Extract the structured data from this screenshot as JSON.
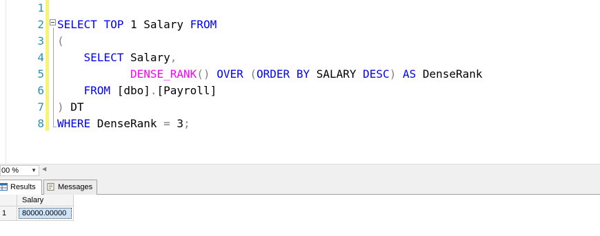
{
  "editor": {
    "line_numbers": [
      "1",
      "2",
      "3",
      "4",
      "5",
      "6",
      "7",
      "8"
    ],
    "lines": [
      [],
      [
        {
          "t": "SELECT",
          "c": "kw"
        },
        {
          "t": " ",
          "c": "id"
        },
        {
          "t": "TOP",
          "c": "kw"
        },
        {
          "t": " 1 Salary ",
          "c": "id"
        },
        {
          "t": "FROM",
          "c": "kw"
        }
      ],
      [
        {
          "t": "(",
          "c": "op"
        }
      ],
      [
        {
          "t": "    ",
          "c": "id"
        },
        {
          "t": "SELECT",
          "c": "kw"
        },
        {
          "t": " Salary",
          "c": "id"
        },
        {
          "t": ",",
          "c": "op"
        }
      ],
      [
        {
          "t": "           ",
          "c": "id"
        },
        {
          "t": "DENSE_RANK",
          "c": "fn"
        },
        {
          "t": "()",
          "c": "op"
        },
        {
          "t": " ",
          "c": "id"
        },
        {
          "t": "OVER",
          "c": "kw"
        },
        {
          "t": " ",
          "c": "id"
        },
        {
          "t": "(",
          "c": "op"
        },
        {
          "t": "ORDER",
          "c": "kw"
        },
        {
          "t": " ",
          "c": "id"
        },
        {
          "t": "BY",
          "c": "kw"
        },
        {
          "t": " SALARY ",
          "c": "id"
        },
        {
          "t": "DESC",
          "c": "kw"
        },
        {
          "t": ")",
          "c": "op"
        },
        {
          "t": " ",
          "c": "id"
        },
        {
          "t": "AS",
          "c": "kw"
        },
        {
          "t": " DenseRank",
          "c": "id"
        }
      ],
      [
        {
          "t": "    ",
          "c": "id"
        },
        {
          "t": "FROM",
          "c": "kw"
        },
        {
          "t": " [dbo]",
          "c": "id"
        },
        {
          "t": ".",
          "c": "op"
        },
        {
          "t": "[Payroll]",
          "c": "id"
        }
      ],
      [
        {
          "t": ")",
          "c": "op"
        },
        {
          "t": " DT",
          "c": "id"
        }
      ],
      [
        {
          "t": "WHERE",
          "c": "kw"
        },
        {
          "t": " DenseRank ",
          "c": "id"
        },
        {
          "t": "=",
          "c": "op"
        },
        {
          "t": " 3",
          "c": "id"
        },
        {
          "t": ";",
          "c": "op"
        }
      ]
    ]
  },
  "status": {
    "zoom_value": "00 %"
  },
  "tabs": {
    "results_label": "Results",
    "messages_label": "Messages"
  },
  "grid": {
    "columns": [
      "Salary"
    ],
    "rows": [
      {
        "num": "1",
        "cells": [
          "80000.00000"
        ]
      }
    ]
  }
}
